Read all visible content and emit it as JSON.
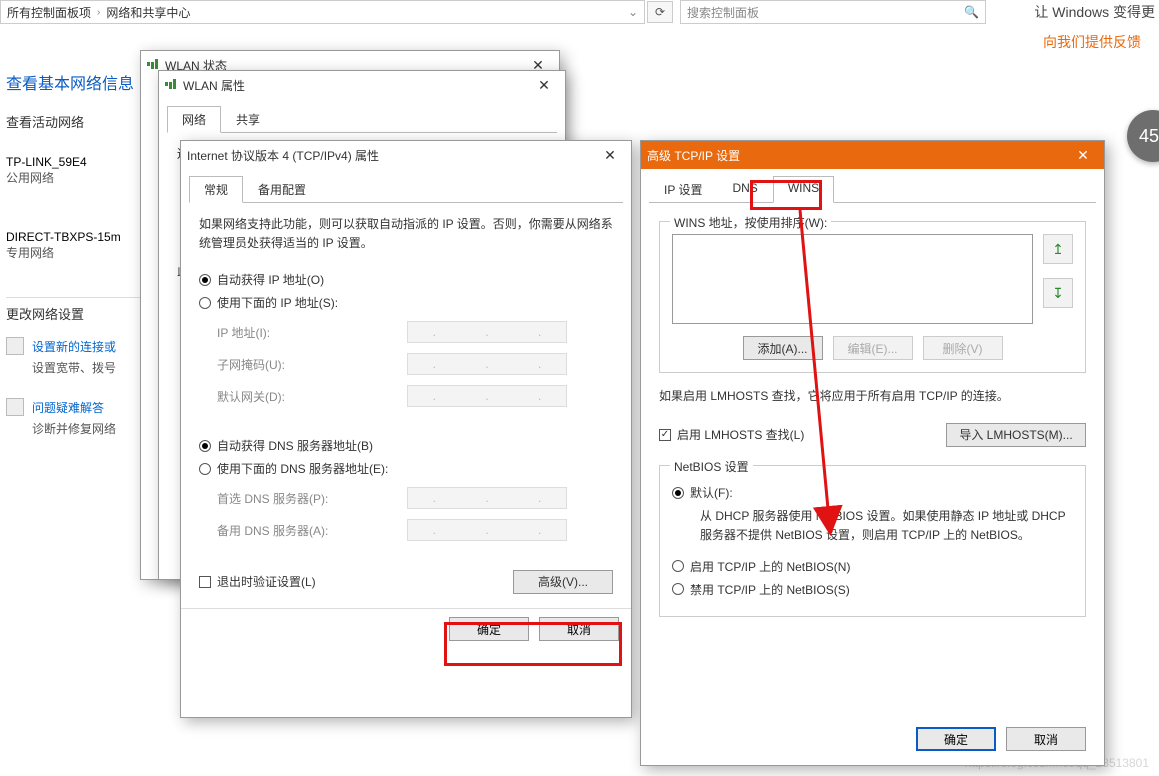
{
  "addressbar": {
    "part1": "所有控制面板项",
    "part2": "网络和共享中心"
  },
  "search": {
    "placeholder": "搜索控制面板"
  },
  "rightside": {
    "line1": "让 Windows 变得更",
    "feedback": "向我们提供反馈",
    "badge": "45"
  },
  "watermark": "https://blog.csdn.net/qq_28513801",
  "leftpanel": {
    "title": "查看基本网络信息",
    "active_networks": "查看活动网络",
    "net1_name": "TP-LINK_59E4",
    "net1_type": "公用网络",
    "net2_name": "DIRECT-TBXPS-15m",
    "net2_type": "专用网络",
    "change_settings": "更改网络设置",
    "link1": "设置新的连接或",
    "link1_sub": "设置宽带、拨号",
    "link2": "问题疑难解答",
    "link2_sub": "诊断并修复网络"
  },
  "wlanstatus": {
    "title": "WLAN 状态"
  },
  "wlanprops": {
    "title": "WLAN 属性",
    "tab_network": "网络",
    "tab_share": "共享",
    "connect_lbl": "连"
  },
  "ipv4": {
    "title": "Internet 协议版本 4 (TCP/IPv4) 属性",
    "tab_general": "常规",
    "tab_alt": "备用配置",
    "desc": "如果网络支持此功能，则可以获取自动指派的 IP 设置。否则，你需要从网络系统管理员处获得适当的 IP 设置。",
    "radio_auto_ip": "自动获得 IP 地址(O)",
    "radio_manual_ip": "使用下面的 IP 地址(S):",
    "lbl_ip": "IP 地址(I):",
    "lbl_mask": "子网掩码(U):",
    "lbl_gw": "默认网关(D):",
    "radio_auto_dns": "自动获得 DNS 服务器地址(B)",
    "radio_manual_dns": "使用下面的 DNS 服务器地址(E):",
    "lbl_dns1": "首选 DNS 服务器(P):",
    "lbl_dns2": "备用 DNS 服务器(A):",
    "chk_validate": "退出时验证设置(L)",
    "btn_adv": "高级(V)...",
    "btn_ok": "确定",
    "btn_cancel": "取消"
  },
  "adv": {
    "title": "高级 TCP/IP 设置",
    "tab_ip": "IP 设置",
    "tab_dns": "DNS",
    "tab_wins": "WINS",
    "wins_group": "WINS 地址，按使用排序(W):",
    "btn_add": "添加(A)...",
    "btn_edit": "编辑(E)...",
    "btn_del": "删除(V)",
    "lmhosts_note": "如果启用 LMHOSTS 查找，它将应用于所有启用 TCP/IP 的连接。",
    "chk_lmhosts": "启用 LMHOSTS 查找(L)",
    "btn_import": "导入 LMHOSTS(M)...",
    "netbios_group": "NetBIOS 设置",
    "rb_default": "默认(F):",
    "rb_default_desc": "从 DHCP 服务器使用 NetBIOS 设置。如果使用静态 IP 地址或 DHCP 服务器不提供 NetBIOS 设置，则启用 TCP/IP 上的 NetBIOS。",
    "rb_enable": "启用 TCP/IP 上的 NetBIOS(N)",
    "rb_disable": "禁用 TCP/IP 上的 NetBIOS(S)",
    "btn_ok": "确定",
    "btn_cancel": "取消"
  }
}
